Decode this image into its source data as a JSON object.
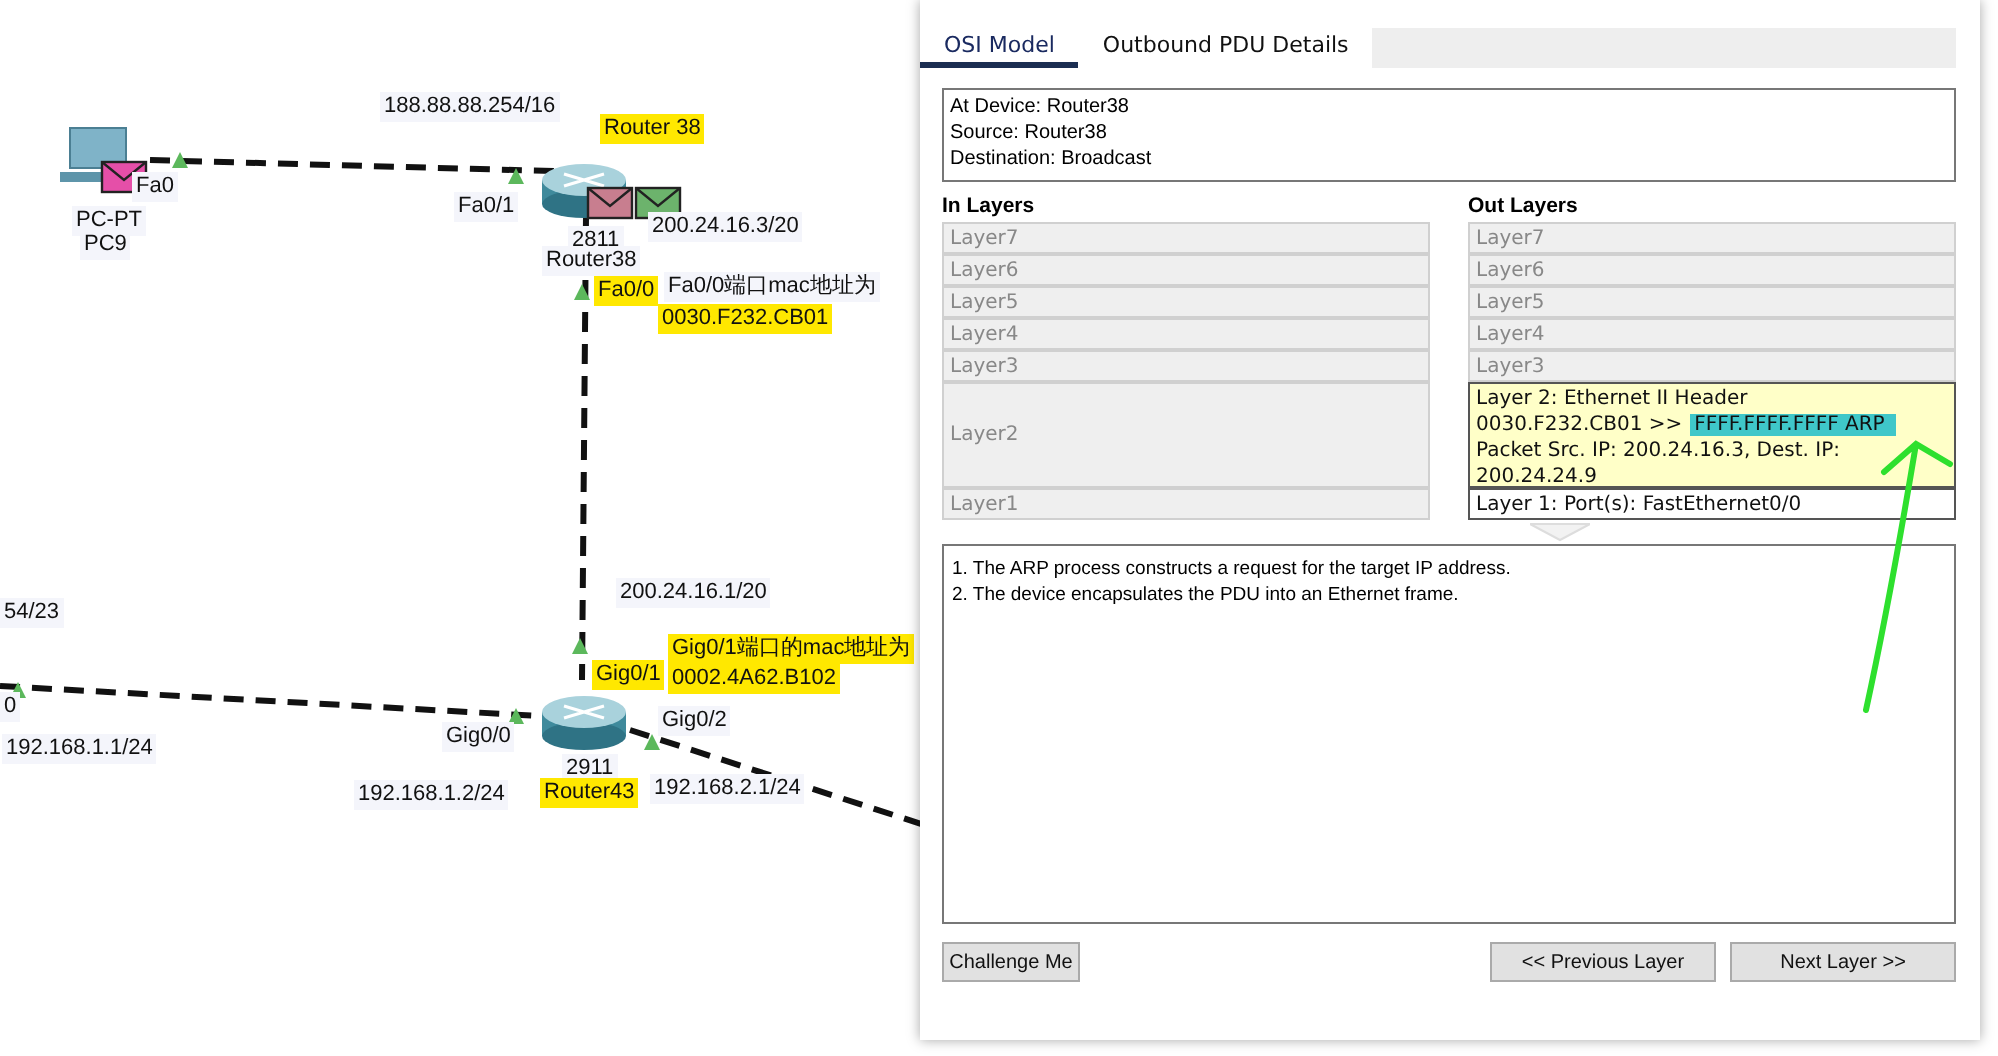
{
  "topology": {
    "labels": [
      {
        "text": "188.88.88.254/16",
        "highlighted": false
      },
      {
        "text": "Router 38",
        "highlighted": true
      },
      {
        "text": "Fa0",
        "highlighted": false
      },
      {
        "text": "PC-PT",
        "highlighted": false
      },
      {
        "text": "PC9",
        "highlighted": false
      },
      {
        "text": "Fa0/1",
        "highlighted": false
      },
      {
        "text": "200.24.16.3/20",
        "highlighted": false
      },
      {
        "text": "2811",
        "highlighted": false
      },
      {
        "text": "Router38",
        "highlighted": false
      },
      {
        "text": "Fa0/0",
        "highlighted": true
      },
      {
        "text": "Fa0/0端口mac地址为",
        "highlighted": false
      },
      {
        "text": "0030.F232.CB01",
        "highlighted": true
      },
      {
        "text": "200.24.16.1/20",
        "highlighted": false
      },
      {
        "text": "Gig0/1端口的mac地址为",
        "highlighted": true
      },
      {
        "text": "Gig0/1",
        "highlighted": true
      },
      {
        "text": "0002.4A62.B102",
        "highlighted": true
      },
      {
        "text": "54/23",
        "highlighted": false
      },
      {
        "text": "0",
        "highlighted": false
      },
      {
        "text": "192.168.1.1/24",
        "highlighted": false
      },
      {
        "text": "Gig0/0",
        "highlighted": false
      },
      {
        "text": "Gig0/2",
        "highlighted": false
      },
      {
        "text": "2911",
        "highlighted": false
      },
      {
        "text": "192.168.1.2/24",
        "highlighted": false
      },
      {
        "text": "Router43",
        "highlighted": true
      },
      {
        "text": "192.168.2.1/24",
        "highlighted": false
      }
    ]
  },
  "dialog": {
    "tabs": [
      {
        "label": "OSI Model",
        "selected": true
      },
      {
        "label": "Outbound PDU Details",
        "selected": false
      }
    ],
    "info": [
      "At Device: Router38",
      "Source: Router38",
      "Destination: Broadcast"
    ],
    "in_layers": {
      "title": "In Layers",
      "layers": [
        {
          "lines": [
            "Layer7"
          ],
          "active": false,
          "selected": false
        },
        {
          "lines": [
            "Layer6"
          ],
          "active": false,
          "selected": false
        },
        {
          "lines": [
            "Layer5"
          ],
          "active": false,
          "selected": false
        },
        {
          "lines": [
            "Layer4"
          ],
          "active": false,
          "selected": false
        },
        {
          "lines": [
            "Layer3"
          ],
          "active": false,
          "selected": false
        },
        {
          "lines": [
            "Layer2"
          ],
          "active": false,
          "selected": false
        },
        {
          "lines": [
            "Layer1"
          ],
          "active": false,
          "selected": false
        }
      ]
    },
    "out_layers": {
      "title": "Out Layers",
      "layers": [
        {
          "lines": [
            "Layer7"
          ],
          "active": false,
          "selected": false
        },
        {
          "lines": [
            "Layer6"
          ],
          "active": false,
          "selected": false
        },
        {
          "lines": [
            "Layer5"
          ],
          "active": false,
          "selected": false
        },
        {
          "lines": [
            "Layer4"
          ],
          "active": false,
          "selected": false
        },
        {
          "lines": [
            "Layer3"
          ],
          "active": false,
          "selected": false
        },
        {
          "lines": [
            "Layer 2: Ethernet II Header",
            "0030.F232.CB01 >>",
            "Packet Src. IP: 200.24.16.3, Dest. IP:",
            "200.24.24.9"
          ],
          "marked": "FFFF.FFFF.FFFF ARP",
          "active": true,
          "selected": true
        },
        {
          "lines": [
            "Layer 1: Port(s): FastEthernet0/0"
          ],
          "active": true,
          "selected": false
        }
      ]
    },
    "description": [
      "1. The ARP process constructs a request for the target IP address.",
      "2. The device encapsulates the PDU into an Ethernet frame."
    ],
    "buttons": {
      "left": "Challenge Me",
      "right": [
        "<< Previous Layer",
        "Next Layer >>"
      ]
    }
  }
}
